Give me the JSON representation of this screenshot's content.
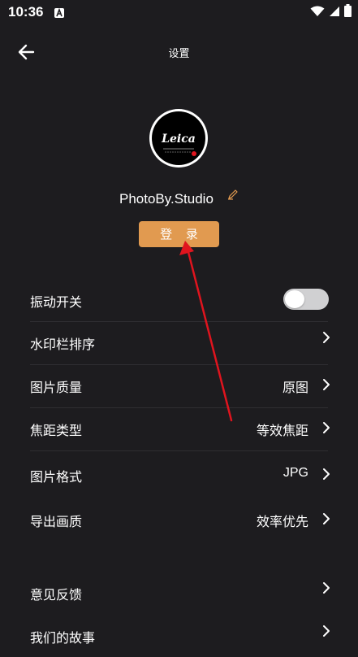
{
  "status_bar": {
    "time": "10:36",
    "notification_icon": "a-notification-icon",
    "icons": [
      "wifi-icon",
      "cell-signal-icon",
      "battery-icon"
    ]
  },
  "header": {
    "title": "设置",
    "back_icon": "arrow-left-icon"
  },
  "profile": {
    "avatar_logo_text": "Leica",
    "username": "PhotoBy.Studio",
    "edit_icon": "pencil-icon",
    "login_label": "登 录"
  },
  "colors": {
    "background": "#1d1c1f",
    "accent": "#e19a50",
    "annotation": "#e0141e",
    "toggle_off": "#d0d0d2"
  },
  "settings": [
    {
      "label": "振动开关",
      "type": "toggle",
      "on": false
    },
    {
      "label": "水印栏排序",
      "type": "link",
      "value": ""
    },
    {
      "label": "图片质量",
      "type": "link",
      "value": "原图"
    },
    {
      "label": "焦距类型",
      "type": "link",
      "value": "等效焦距"
    },
    {
      "label": "图片格式",
      "type": "link",
      "value": "JPG"
    },
    {
      "label": "导出画质",
      "type": "link",
      "value": "效率优先"
    }
  ],
  "more": [
    {
      "label": "意见反馈"
    },
    {
      "label": "我们的故事"
    }
  ]
}
